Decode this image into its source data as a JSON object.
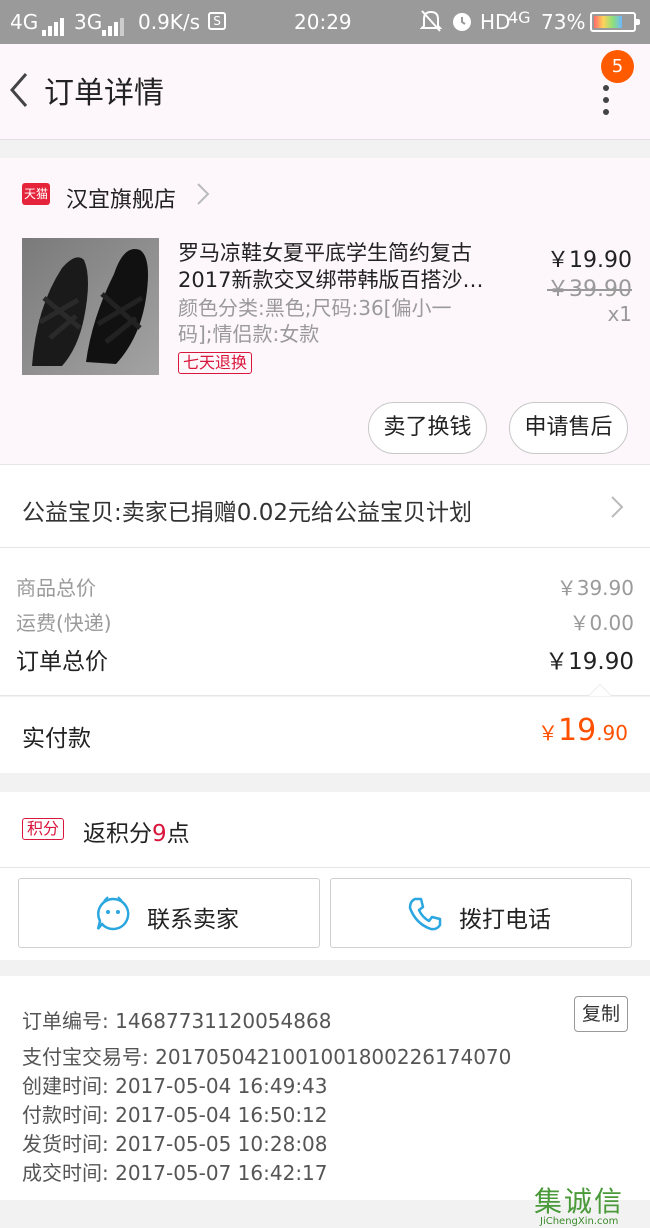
{
  "status_bar": {
    "net1": "4G",
    "net2": "3G",
    "speed": "0.9K/s",
    "time": "20:29",
    "hd": "HD",
    "net3": "4G",
    "battery": "73%",
    "battery_level": 0.73
  },
  "header": {
    "title": "订单详情",
    "badge_count": "5"
  },
  "store": {
    "badge": "天猫",
    "name": "汉宜旗舰店"
  },
  "product": {
    "title_line1": "罗马凉鞋女夏平底学生简约复古",
    "title_line2": "2017新款交叉绑带韩版百搭沙…",
    "sku_line1": "颜色分类:黑色;尺码:36[偏小一",
    "sku_line2": "码];情侣款:女款",
    "tag": "七天退换",
    "price": "￥19.90",
    "original_price": "￥39.90",
    "quantity": "x1"
  },
  "actions": {
    "resell": "卖了换钱",
    "after_sale": "申请售后"
  },
  "charity": {
    "text": "公益宝贝:卖家已捐赠0.02元给公益宝贝计划"
  },
  "summary": {
    "goods_label": "商品总价",
    "goods_value": "￥39.90",
    "shipping_label": "运费(快递)",
    "shipping_value": "￥0.00",
    "total_label": "订单总价",
    "total_value": "￥19.90"
  },
  "paid": {
    "label": "实付款",
    "currency": "￥",
    "int": "19",
    "dec": ".90"
  },
  "points": {
    "badge": "积分",
    "prefix": "返积分",
    "num": "9",
    "suffix": "点"
  },
  "contact": {
    "seller": "联系卖家",
    "phone": "拨打电话"
  },
  "order_info": {
    "order_no": "订单编号: 14687731120054868",
    "copy": "复制",
    "alipay_no": "支付宝交易号: 2017050421001001800226174070",
    "created": "创建时间: 2017-05-04 16:49:43",
    "paid": "付款时间: 2017-05-04 16:50:12",
    "shipped": "发货时间: 2017-05-05 10:28:08",
    "completed": "成交时间: 2017-05-07 16:42:17"
  },
  "watermark": {
    "big": "集诚信",
    "small": "JiChengXin.com"
  },
  "colors": {
    "accent_orange": "#ff5000",
    "tmall_red": "#e5243b",
    "tag_red": "#d9163c",
    "header_bg": "#fdf7fb"
  }
}
